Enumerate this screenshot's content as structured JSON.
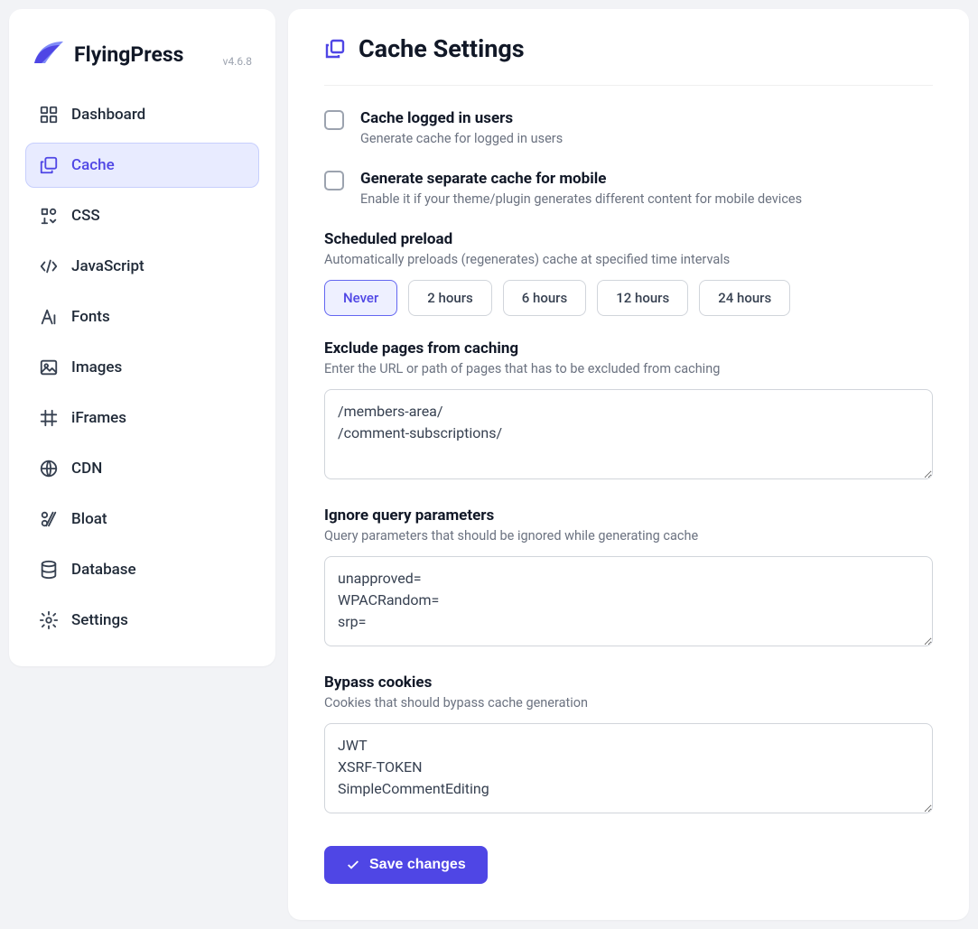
{
  "brand": {
    "name": "FlyingPress",
    "version": "v4.6.8"
  },
  "sidebar": {
    "items": [
      {
        "label": "Dashboard",
        "icon": "dashboard-icon",
        "active": false
      },
      {
        "label": "Cache",
        "icon": "cache-icon",
        "active": true
      },
      {
        "label": "CSS",
        "icon": "css-icon",
        "active": false
      },
      {
        "label": "JavaScript",
        "icon": "javascript-icon",
        "active": false
      },
      {
        "label": "Fonts",
        "icon": "fonts-icon",
        "active": false
      },
      {
        "label": "Images",
        "icon": "images-icon",
        "active": false
      },
      {
        "label": "iFrames",
        "icon": "iframes-icon",
        "active": false
      },
      {
        "label": "CDN",
        "icon": "cdn-icon",
        "active": false
      },
      {
        "label": "Bloat",
        "icon": "bloat-icon",
        "active": false
      },
      {
        "label": "Database",
        "icon": "database-icon",
        "active": false
      },
      {
        "label": "Settings",
        "icon": "settings-icon",
        "active": false
      }
    ]
  },
  "page": {
    "title": "Cache Settings"
  },
  "options": {
    "cache_logged_in": {
      "title": "Cache logged in users",
      "desc": "Generate cache for logged in users",
      "checked": false
    },
    "separate_mobile": {
      "title": "Generate separate cache for mobile",
      "desc": "Enable it if your theme/plugin generates different content for mobile devices",
      "checked": false
    },
    "scheduled_preload": {
      "title": "Scheduled preload",
      "desc": "Automatically preloads (regenerates) cache at specified time intervals",
      "choices": [
        "Never",
        "2 hours",
        "6 hours",
        "12 hours",
        "24 hours"
      ],
      "selected": "Never"
    },
    "exclude_pages": {
      "title": "Exclude pages from caching",
      "desc": "Enter the URL or path of pages that has to be excluded from caching",
      "value": "/members-area/\n/comment-subscriptions/"
    },
    "ignore_query": {
      "title": "Ignore query parameters",
      "desc": "Query parameters that should be ignored while generating cache",
      "value": "unapproved=\nWPACRandom=\nsrp="
    },
    "bypass_cookies": {
      "title": "Bypass cookies",
      "desc": "Cookies that should bypass cache generation",
      "value": "JWT\nXSRF-TOKEN\nSimpleCommentEditing"
    }
  },
  "buttons": {
    "save": "Save changes"
  }
}
